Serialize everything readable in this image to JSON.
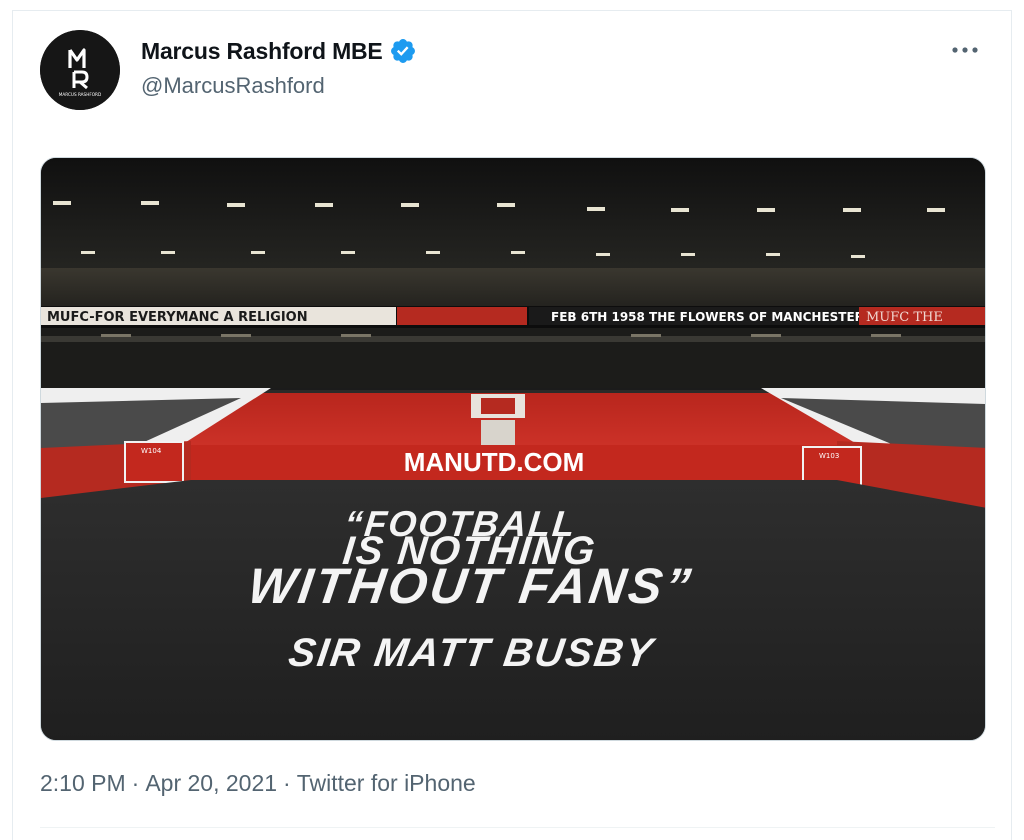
{
  "tweet": {
    "author": {
      "display_name": "Marcus Rashford MBE",
      "handle": "@MarcusRashford",
      "avatar_text": "MARCUS RASHFORD",
      "verified": true
    },
    "media": {
      "banner_left": "MUFC-FOR EVERYMANC A RELIGION",
      "banner_right": "FEB 6TH 1958 THE FLOWERS OF MANCHESTER",
      "banner_right_tail": "MUFC THE",
      "stand_sign": "MANUTD.COM",
      "seat_label_left": "W104",
      "seat_label_right": "W103",
      "quote_line1": "“FOOTBALL",
      "quote_line2": "IS NOTHING",
      "quote_line3": "WITHOUT FANS”",
      "attribution": "SIR MATT BUSBY"
    },
    "meta": {
      "time": "2:10 PM",
      "date": "Apr 20, 2021",
      "source": "Twitter for iPhone",
      "separator": "·"
    }
  },
  "colors": {
    "verified": "#1d9bf0",
    "text_primary": "#0f1419",
    "text_secondary": "#536471",
    "stadium_red": "#c8281f"
  }
}
